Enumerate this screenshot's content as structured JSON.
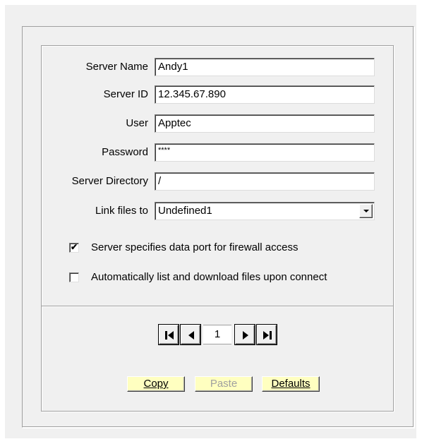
{
  "form": {
    "server_name_label": "Server Name",
    "server_name_value": "Andy1",
    "server_id_label": "Server ID",
    "server_id_value": "12.345.67.890",
    "user_label": "User",
    "user_value": "Apptec",
    "password_label": "Password",
    "password_value": "****",
    "server_directory_label": "Server Directory",
    "server_directory_value": "/",
    "link_files_label": "Link files to",
    "link_files_value": "Undefined1"
  },
  "options": {
    "firewall_label": "Server specifies data port for firewall access",
    "firewall_checked": "✔",
    "autolist_label": "Automatically list and download files upon connect",
    "autolist_checked": ""
  },
  "navigator": {
    "page": "1",
    "icons": [
      "first-record-icon",
      "previous-record-icon",
      "next-record-icon",
      "last-record-icon"
    ]
  },
  "buttons": {
    "copy": "Copy",
    "paste": "Paste",
    "defaults": "Defaults",
    "paste_enabled": false
  },
  "colors": {
    "button_bg": "#ffffc0",
    "window_bg": "#f0f0f0"
  }
}
